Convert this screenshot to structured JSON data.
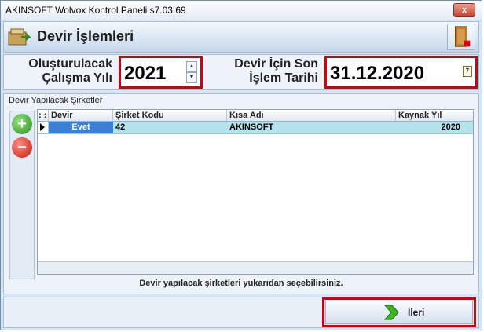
{
  "window": {
    "title": "AKINSOFT Wolvox Kontrol Paneli s7.03.69",
    "close_label": "x"
  },
  "header": {
    "title": "Devir İşlemleri"
  },
  "params": {
    "year_label_line1": "Oluşturulacak",
    "year_label_line2": "Çalışma Yılı",
    "year_value": "2021",
    "date_label_line1": "Devir İçin Son",
    "date_label_line2": "İşlem Tarihi",
    "date_value": "31.12.2020",
    "calendar_day": "7"
  },
  "group": {
    "title": "Devir Yapılacak Şirketler",
    "columns": [
      {
        "label": ": :"
      },
      {
        "label": "Devir"
      },
      {
        "label": "Şirket Kodu"
      },
      {
        "label": "Kısa Adı"
      },
      {
        "label": "Kaynak Yıl"
      }
    ],
    "rows": [
      {
        "devir": "Evet",
        "sirket_kodu": "42",
        "kisa_adi": "AKINSOFT",
        "kaynak_yil": "2020"
      }
    ],
    "hint": "Devir yapılacak şirketleri yukarıdan seçebilirsiniz."
  },
  "footer": {
    "next_label": "İleri"
  },
  "colors": {
    "highlight": "#d6000b",
    "row_selected": "#b5e3ec",
    "evet_cell": "#3c7fd6"
  }
}
